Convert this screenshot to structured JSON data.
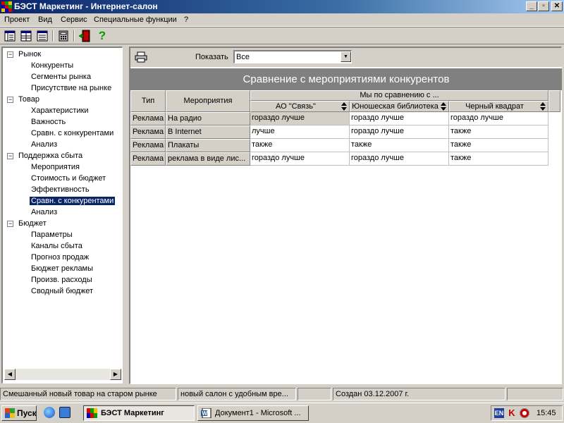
{
  "window": {
    "title": "БЭСТ Маркетинг - Интернет-салон",
    "buttons": {
      "minimize": "_",
      "maximize": "▫",
      "close": "✕"
    }
  },
  "menu": [
    "Проект",
    "Вид",
    "Сервис",
    "Специальные функции",
    "?"
  ],
  "toolbar": {
    "icons": [
      "tree-view-icon",
      "table-view-icon",
      "list-view-icon",
      "calculator-icon",
      "exit-door-icon",
      "help-icon"
    ],
    "help_glyph": "?"
  },
  "tree": {
    "groups": [
      {
        "label": "Рынок",
        "toggle": "−",
        "items": [
          "Конкуренты",
          "Сегменты рынка",
          "Присутствие на рынке"
        ]
      },
      {
        "label": "Товар",
        "toggle": "−",
        "items": [
          "Характеристики",
          "Важность",
          "Сравн. с конкурентами",
          "Анализ"
        ]
      },
      {
        "label": "Поддержка сбыта",
        "toggle": "−",
        "items": [
          "Мероприятия",
          "Стоимость и бюджет",
          "Эффективность",
          "Сравн. с конкурентами",
          "Анализ"
        ]
      },
      {
        "label": "Бюджет",
        "toggle": "−",
        "items": [
          "Параметры",
          "Каналы сбыта",
          "Прогноз продаж",
          "Бюджет рекламы",
          "Произв. расходы",
          "Сводный бюджет"
        ]
      }
    ],
    "selected": "Поддержка сбыта / Сравн. с конкурентами",
    "scroll_left": "◀",
    "scroll_right": "▶"
  },
  "panel": {
    "show_label": "Показать",
    "filter_value": "Все",
    "dropdown_arrow": "▼",
    "title": "Сравнение с мероприятиями конкурентов"
  },
  "grid": {
    "col_type": "Тип",
    "col_event": "Мероприятия",
    "group_header": "Мы по сравнению с ...",
    "competitors": [
      "АО \"Связь\"",
      "Юношеская библиотека",
      "Черный квадрат"
    ],
    "rows": [
      {
        "type": "Реклама",
        "event": "На радио",
        "values": [
          "гораздо лучше",
          "гораздо лучше",
          "гораздо лучше"
        ]
      },
      {
        "type": "Реклама",
        "event": "В Internet",
        "values": [
          "лучше",
          "гораздо лучше",
          "также"
        ]
      },
      {
        "type": "Реклама",
        "event": "Плакаты",
        "values": [
          "также",
          "также",
          "также"
        ]
      },
      {
        "type": "Реклама",
        "event": "реклама в виде лис...",
        "values": [
          "гораздо лучше",
          "гораздо лучше",
          "также"
        ]
      }
    ]
  },
  "statusbar": {
    "panels": [
      "Смешанный новый товар на старом рынке",
      "новый салон с удобным вре...",
      "",
      "Создан 03.12.2007 г."
    ]
  },
  "taskbar": {
    "start_label": "Пуск",
    "tasks": [
      {
        "label": "БЭСТ Маркетинг",
        "active": true
      },
      {
        "label": "Документ1 - Microsoft ...",
        "active": false
      }
    ],
    "tray": {
      "lang": "EN",
      "clock": "15:45"
    }
  },
  "colors": {
    "titlebar": "#0a246a",
    "selection": "#0a246a",
    "banner": "#808080",
    "face": "#d4d0c8"
  }
}
